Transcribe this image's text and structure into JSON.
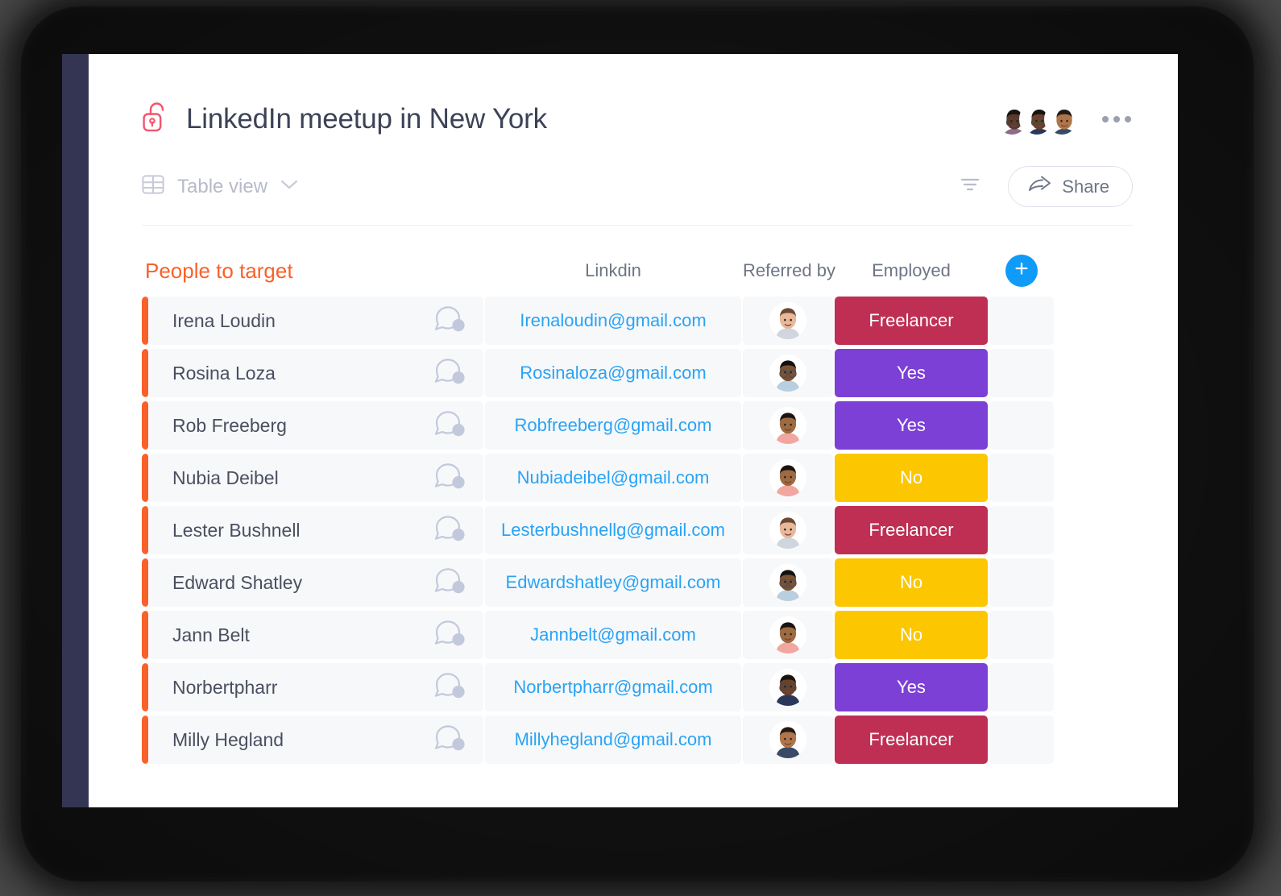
{
  "header": {
    "title": "LinkedIn meetup in New York",
    "lock_icon": "lock-open-icon",
    "more_menu_icon": "ellipsis-icon",
    "collaborators": [
      {
        "name": "collaborator-1",
        "skin": "#5a3a2a",
        "hair": "#1b1410",
        "shirt": "#8e6b8a",
        "glasses": true
      },
      {
        "name": "collaborator-2",
        "skin": "#6b4126",
        "hair": "#171310",
        "shirt": "#2b3758",
        "glasses": true
      },
      {
        "name": "collaborator-3",
        "skin": "#b0754a",
        "hair": "#241a14",
        "shirt": "#3a4a66",
        "glasses": false
      }
    ]
  },
  "toolbar": {
    "view_label": "Table view",
    "view_icon": "table-grid-icon",
    "chevron_icon": "chevron-down-icon",
    "filter_icon": "filter-icon",
    "share_label": "Share",
    "share_icon": "share-arrow-icon"
  },
  "table": {
    "headers": {
      "main": "People to target",
      "linkdin": "Linkdin",
      "referred_by": "Referred by",
      "employed": "Employed"
    },
    "add_button_label": "+",
    "accent_bar_color": "#f9612a",
    "row_bg": "#f7f8fa",
    "status_colors": {
      "Freelancer": "#bf2f53",
      "Yes": "#7c40d6",
      "No": "#fcc700"
    },
    "rows": [
      {
        "name": "Irena Loudin",
        "email": "Irenaloudin@gmail.com",
        "status": "Freelancer",
        "status_color": "#bf2f53",
        "chat_icon": "chat-bubble-icon",
        "avatar": {
          "name": "avatar-irena",
          "skin": "#e8b89a",
          "hair": "#6b4a33",
          "shirt": "#cfd6de",
          "glasses": false
        }
      },
      {
        "name": "Rosina Loza",
        "email": "Rosinaloza@gmail.com",
        "status": "Yes",
        "status_color": "#7c40d6",
        "chat_icon": "chat-bubble-icon",
        "avatar": {
          "name": "avatar-rosina",
          "skin": "#7a5336",
          "hair": "#15110e",
          "shirt": "#b9cfe0",
          "glasses": true
        }
      },
      {
        "name": "Rob Freeberg",
        "email": "Robfreeberg@gmail.com",
        "status": "Yes",
        "status_color": "#7c40d6",
        "chat_icon": "chat-bubble-icon",
        "avatar": {
          "name": "avatar-rob",
          "skin": "#9d6a42",
          "hair": "#1a1310",
          "shirt": "#f2a6a0",
          "glasses": false
        }
      },
      {
        "name": "Nubia Deibel",
        "email": "Nubiadeibel@gmail.com",
        "status": "No",
        "status_color": "#fcc700",
        "chat_icon": "chat-bubble-icon",
        "avatar": {
          "name": "avatar-nubia",
          "skin": "#9d6a42",
          "hair": "#1a1310",
          "shirt": "#f2a6a0",
          "glasses": false
        }
      },
      {
        "name": "Lester Bushnell",
        "email": "Lesterbushnellg@gmail.com",
        "status": "Freelancer",
        "status_color": "#bf2f53",
        "chat_icon": "chat-bubble-icon",
        "avatar": {
          "name": "avatar-lester",
          "skin": "#e8b89a",
          "hair": "#6b4a33",
          "shirt": "#cfd6de",
          "glasses": false
        }
      },
      {
        "name": "Edward Shatley",
        "email": "Edwardshatley@gmail.com",
        "status": "No",
        "status_color": "#fcc700",
        "chat_icon": "chat-bubble-icon",
        "avatar": {
          "name": "avatar-edward",
          "skin": "#7a5336",
          "hair": "#15110e",
          "shirt": "#b9cfe0",
          "glasses": true
        }
      },
      {
        "name": "Jann Belt",
        "email": "Jannbelt@gmail.com",
        "status": "No",
        "status_color": "#fcc700",
        "chat_icon": "chat-bubble-icon",
        "avatar": {
          "name": "avatar-jann",
          "skin": "#9d6a42",
          "hair": "#1a1310",
          "shirt": "#f2a6a0",
          "glasses": false
        }
      },
      {
        "name": "Norbertpharr",
        "email": "Norbertpharr@gmail.com",
        "status": "Yes",
        "status_color": "#7c40d6",
        "chat_icon": "chat-bubble-icon",
        "avatar": {
          "name": "avatar-norbert",
          "skin": "#6b4126",
          "hair": "#171310",
          "shirt": "#2b3758",
          "glasses": true
        }
      },
      {
        "name": "Milly Hegland",
        "email": "Millyhegland@gmail.com",
        "status": "Freelancer",
        "status_color": "#bf2f53",
        "chat_icon": "chat-bubble-icon",
        "avatar": {
          "name": "avatar-milly",
          "skin": "#b0754a",
          "hair": "#241a14",
          "shirt": "#3a4a66",
          "glasses": false
        }
      }
    ]
  }
}
